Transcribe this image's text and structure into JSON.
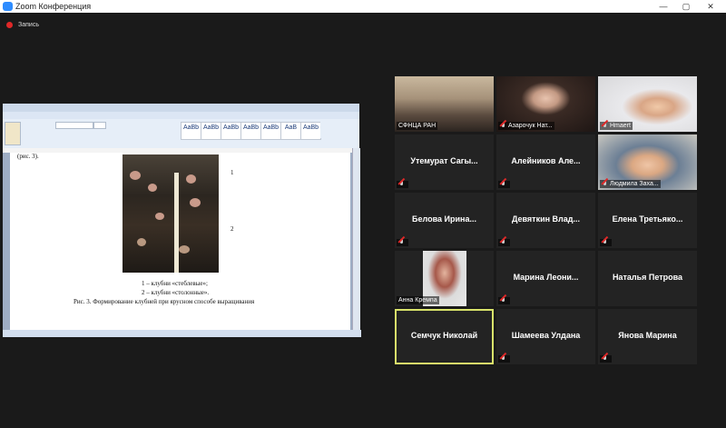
{
  "window": {
    "title": "Zoom Конференция"
  },
  "window_controls": {
    "minimize": "—",
    "maximize": "▢",
    "close": "✕"
  },
  "recording": {
    "label": "Запись"
  },
  "shared_document": {
    "caption_top": "(рис. 3).",
    "label_1": "1",
    "label_2": "2",
    "legend_1": "1 – клубни «стеблевые»;",
    "legend_2": "2 – клубни «столонные».",
    "figure_caption": "Рис. 3. Формирование клубней при ярусном способе выращивания"
  },
  "participants": [
    {
      "name": "",
      "tag": "СФНЦА РАН",
      "video": true,
      "muted": false
    },
    {
      "name": "",
      "tag": "Азарочук Нат...",
      "video": true,
      "muted": true
    },
    {
      "name": "",
      "tag": "Hmaert",
      "video": true,
      "muted": true
    },
    {
      "name": "Утемурат Сагы...",
      "tag": "",
      "video": false,
      "muted": true
    },
    {
      "name": "Алейников Але...",
      "tag": "",
      "video": false,
      "muted": true
    },
    {
      "name": "",
      "tag": "Людмила Заха...",
      "video": true,
      "muted": true
    },
    {
      "name": "Белова Ирина...",
      "tag": "",
      "video": false,
      "muted": true
    },
    {
      "name": "Девяткин Влад...",
      "tag": "",
      "video": false,
      "muted": true
    },
    {
      "name": "Елена Третьяко...",
      "tag": "",
      "video": false,
      "muted": true
    },
    {
      "name": "",
      "tag": "Анна Кремпа",
      "video": true,
      "muted": false
    },
    {
      "name": "Марина Леони...",
      "tag": "",
      "video": false,
      "muted": true
    },
    {
      "name": "Наталья Петрова",
      "tag": "",
      "video": false,
      "muted": false
    },
    {
      "name": "Семчук Николай",
      "tag": "",
      "video": false,
      "muted": false,
      "active_speaker": true
    },
    {
      "name": "Шамеева Улдана",
      "tag": "",
      "video": false,
      "muted": true
    },
    {
      "name": "Янова Марина",
      "tag": "",
      "video": false,
      "muted": true
    }
  ]
}
